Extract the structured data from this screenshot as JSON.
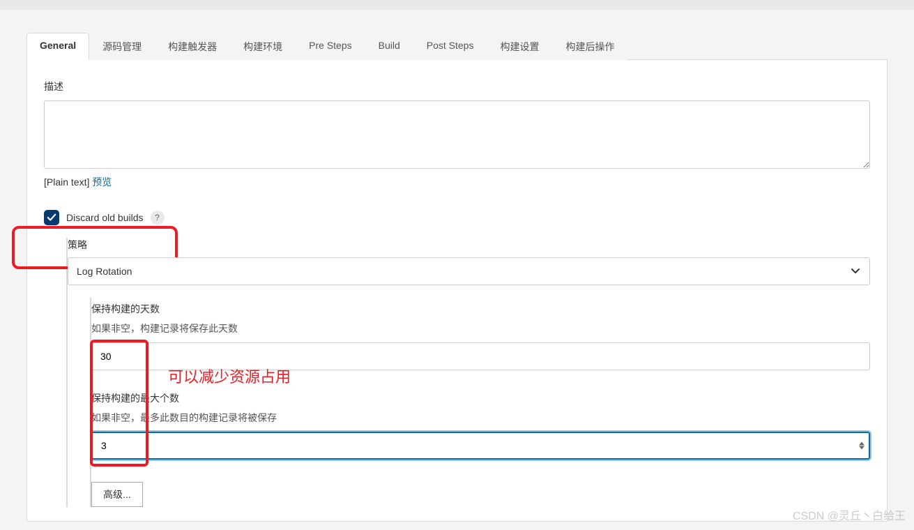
{
  "tabs": {
    "general": "General",
    "scm": "源码管理",
    "triggers": "构建触发器",
    "env": "构建环境",
    "presteps": "Pre Steps",
    "build": "Build",
    "poststeps": "Post Steps",
    "settings": "构建设置",
    "postbuild": "构建后操作"
  },
  "description": {
    "label": "描述",
    "value": "",
    "plain_text_prefix": "[Plain text] ",
    "preview_link": "预览"
  },
  "discard": {
    "label": "Discard old builds",
    "checked": true,
    "help": "?"
  },
  "strategy": {
    "label": "策略",
    "selected": "Log Rotation"
  },
  "days_to_keep": {
    "label": "保持构建的天数",
    "help": "如果非空，构建记录将保存此天数",
    "value": "30"
  },
  "max_to_keep": {
    "label": "保持构建的最大个数",
    "help": "如果非空，最多此数目的构建记录将被保存",
    "value": "3"
  },
  "advanced_button": "高级...",
  "annotation": "可以减少资源占用",
  "watermark": "CSDN @灵丘丶白给王"
}
